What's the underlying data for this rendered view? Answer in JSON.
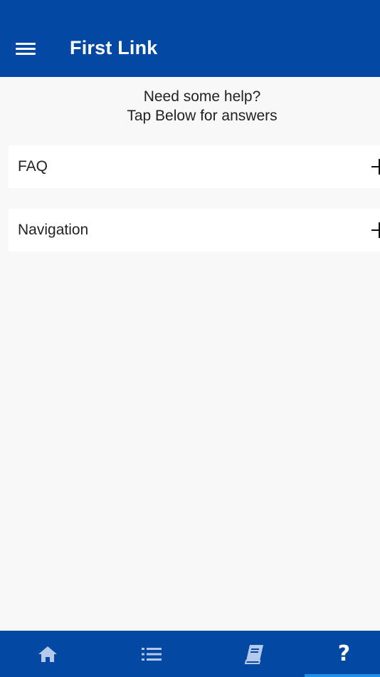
{
  "app_bar": {
    "title": "First Link",
    "menu_icon": "hamburger-menu-icon"
  },
  "help": {
    "line1": "Need some help?",
    "line2": "Tap Below for answers"
  },
  "sections": [
    {
      "label": "FAQ",
      "icon": "plus-icon"
    },
    {
      "label": "Navigation",
      "icon": "plus-icon"
    }
  ],
  "bottom_nav": {
    "items": [
      {
        "name": "home",
        "icon": "home-icon",
        "active": false
      },
      {
        "name": "list",
        "icon": "list-icon",
        "active": false
      },
      {
        "name": "book",
        "icon": "book-icon",
        "active": false
      },
      {
        "name": "help",
        "icon": "help-icon",
        "glyph": "?",
        "active": true
      }
    ],
    "active_color": "#1e8ee6"
  },
  "colors": {
    "brand_blue": "#0348a3",
    "background": "#f8f8f8"
  }
}
